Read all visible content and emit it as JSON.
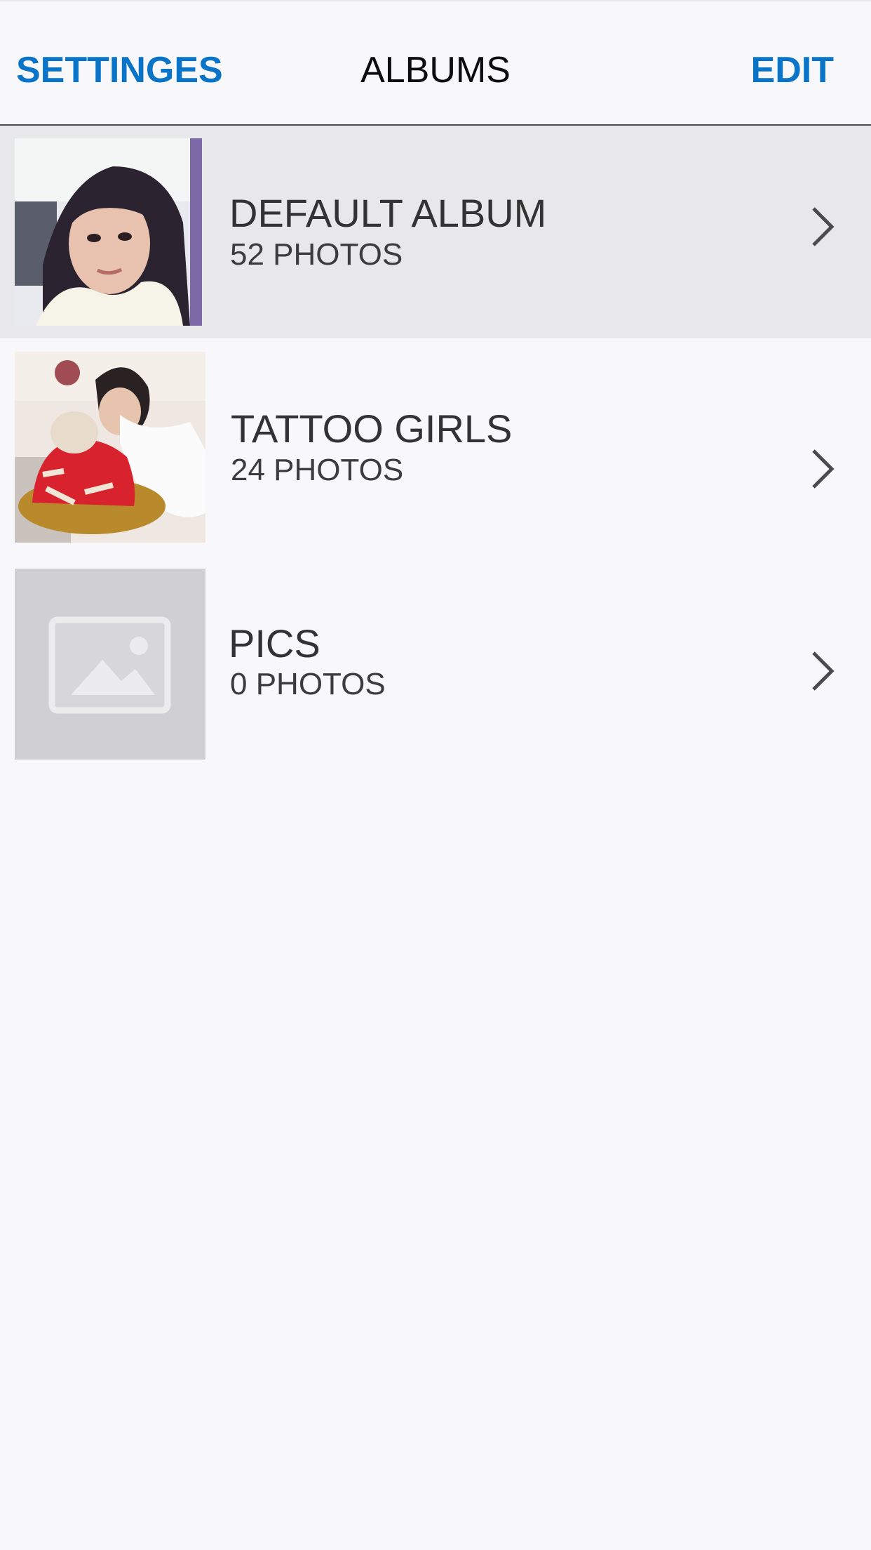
{
  "theme": {
    "accent": "#0a74c8",
    "selected_row": "#e8e7ea",
    "background": "#f8f7fa"
  },
  "navbar": {
    "left_label": "SETTINGES",
    "title": "ALBUMS",
    "right_label": "EDIT"
  },
  "albums": [
    {
      "name": "DEFAULT ALBUM",
      "count": "52 PHOTOS",
      "selected": true,
      "thumbnail": "portrait-photo"
    },
    {
      "name": "TATTOO GIRLS",
      "count": "24 PHOTOS",
      "selected": false,
      "thumbnail": "cake-photo"
    },
    {
      "name": "PICS",
      "count": "0 PHOTOS",
      "selected": false,
      "thumbnail": "image-placeholder-icon"
    }
  ]
}
